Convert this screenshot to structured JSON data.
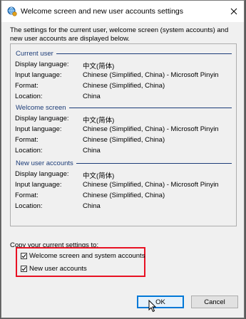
{
  "window": {
    "title": "Welcome screen and new user accounts settings",
    "intro_text": "The settings for the current user, welcome screen (system accounts) and new user accounts are displayed below."
  },
  "sections": [
    {
      "title": "Current user",
      "rows": [
        {
          "label": "Display language:",
          "value": "中文(简体)"
        },
        {
          "label": "Input language:",
          "value": "Chinese (Simplified, China) - Microsoft Pinyin"
        },
        {
          "label": "Format:",
          "value": "Chinese (Simplified, China)"
        },
        {
          "label": "Location:",
          "value": "China"
        }
      ]
    },
    {
      "title": "Welcome screen",
      "rows": [
        {
          "label": "Display language:",
          "value": "中文(简体)"
        },
        {
          "label": "Input language:",
          "value": "Chinese (Simplified, China) - Microsoft Pinyin"
        },
        {
          "label": "Format:",
          "value": "Chinese (Simplified, China)"
        },
        {
          "label": "Location:",
          "value": "China"
        }
      ]
    },
    {
      "title": "New user accounts",
      "rows": [
        {
          "label": "Display language:",
          "value": "中文(简体)"
        },
        {
          "label": "Input language:",
          "value": "Chinese (Simplified, China) - Microsoft Pinyin"
        },
        {
          "label": "Format:",
          "value": "Chinese (Simplified, China)"
        },
        {
          "label": "Location:",
          "value": "China"
        }
      ]
    }
  ],
  "copy": {
    "label": "Copy your current settings to:",
    "options": [
      {
        "label": "Welcome screen and system accounts",
        "checked": true
      },
      {
        "label": "New user accounts",
        "checked": true
      }
    ]
  },
  "buttons": {
    "ok": "OK",
    "cancel": "Cancel"
  },
  "colors": {
    "section_header": "#1c3c78",
    "highlight_box": "#e81123",
    "default_button_border": "#0078d7"
  },
  "icons": {
    "title": "globe-settings-icon",
    "close": "close-icon",
    "checkbox": "checkmark-icon",
    "cursor": "mouse-pointer-icon"
  }
}
